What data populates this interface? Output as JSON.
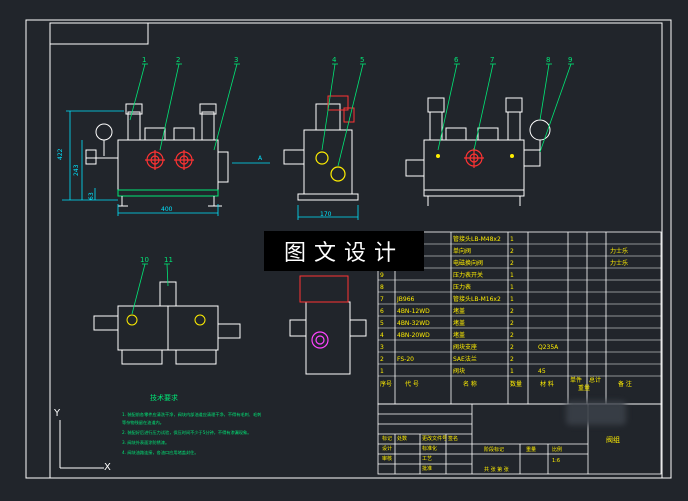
{
  "watermark": "图文设计",
  "dims": {
    "h422": "422",
    "h243": "243",
    "h63": "63",
    "w400": "400",
    "w170": "170",
    "arrowA": "A"
  },
  "balloons": [
    "1",
    "2",
    "3",
    "4",
    "5",
    "6",
    "7",
    "8",
    "9",
    "10",
    "11"
  ],
  "bom": {
    "rows": [
      {
        "no": "",
        "code": "",
        "name": "管接头LB-M48x2",
        "qty": "1",
        "mat": "",
        "note": ""
      },
      {
        "no": "",
        "code": "",
        "name": "单向阀",
        "qty": "2",
        "mat": "",
        "note": "力士乐"
      },
      {
        "no": "",
        "code": "",
        "name": "电磁换向阀",
        "qty": "2",
        "mat": "",
        "note": "力士乐"
      },
      {
        "no": "9",
        "code": "",
        "name": "压力表开关",
        "qty": "1",
        "mat": "",
        "note": ""
      },
      {
        "no": "8",
        "code": "",
        "name": "压力表",
        "qty": "1",
        "mat": "",
        "note": ""
      },
      {
        "no": "7",
        "code": "JB966",
        "name": "管接头LB-M16x2",
        "qty": "1",
        "mat": "",
        "note": ""
      },
      {
        "no": "6",
        "code": "4BN-12WD",
        "name": "堵盖",
        "qty": "2",
        "mat": "",
        "note": ""
      },
      {
        "no": "5",
        "code": "4BN-32WD",
        "name": "堵盖",
        "qty": "2",
        "mat": "",
        "note": ""
      },
      {
        "no": "4",
        "code": "4BN-20WD",
        "name": "堵盖",
        "qty": "2",
        "mat": "",
        "note": ""
      },
      {
        "no": "3",
        "code": "",
        "name": "阀块支座",
        "qty": "2",
        "mat": "Q235A",
        "note": ""
      },
      {
        "no": "2",
        "code": "FS-20",
        "name": "SAE法兰",
        "qty": "2",
        "mat": "",
        "note": ""
      },
      {
        "no": "1",
        "code": "",
        "name": "阀块",
        "qty": "1",
        "mat": "45",
        "note": ""
      }
    ],
    "header": {
      "no": "序号",
      "code": "代 号",
      "name": "名 称",
      "qty": "数量",
      "mat": "材 料",
      "unitw": "单件",
      "totalw": "总计",
      "weight": "重量",
      "note": "备 注"
    }
  },
  "notes": {
    "title": "技术要求",
    "lines": [
      "1. 装配前各零件应清洗干净，阀块内部油道应清理干净，不得有毛刺、毛刺",
      "   等杂物残留在油道内。",
      "2. 装配好后进行压力试验，保压时间不少于5分钟，不得有渗漏现象。",
      "3. 阀块外表面涂防锈漆。",
      "4. 阀块油路连接，各油口应用堵盖封住。"
    ]
  },
  "titleblock": {
    "part_name": "阀组",
    "scale_label": "比例",
    "scale_value": "1:6",
    "sheet_label": "共 张 第 张",
    "weight_label": "重量",
    "stage_label": "阶段标记",
    "design": "设计",
    "check": "审核",
    "process": "工艺",
    "approve": "批准",
    "std": "标准化",
    "mark": "标记",
    "count": "处数",
    "zone": "分区",
    "doc": "更改文件号",
    "sign": "签名",
    "date": "年月日"
  },
  "axis": {
    "y": "Y",
    "x": "X"
  },
  "colors": {
    "bg": "#21252b",
    "line": "#ffffff",
    "green": "#00e676",
    "cyan": "#00e5ff",
    "yellow": "#ffee00",
    "red": "#ff3333",
    "magenta": "#ff44ff"
  }
}
